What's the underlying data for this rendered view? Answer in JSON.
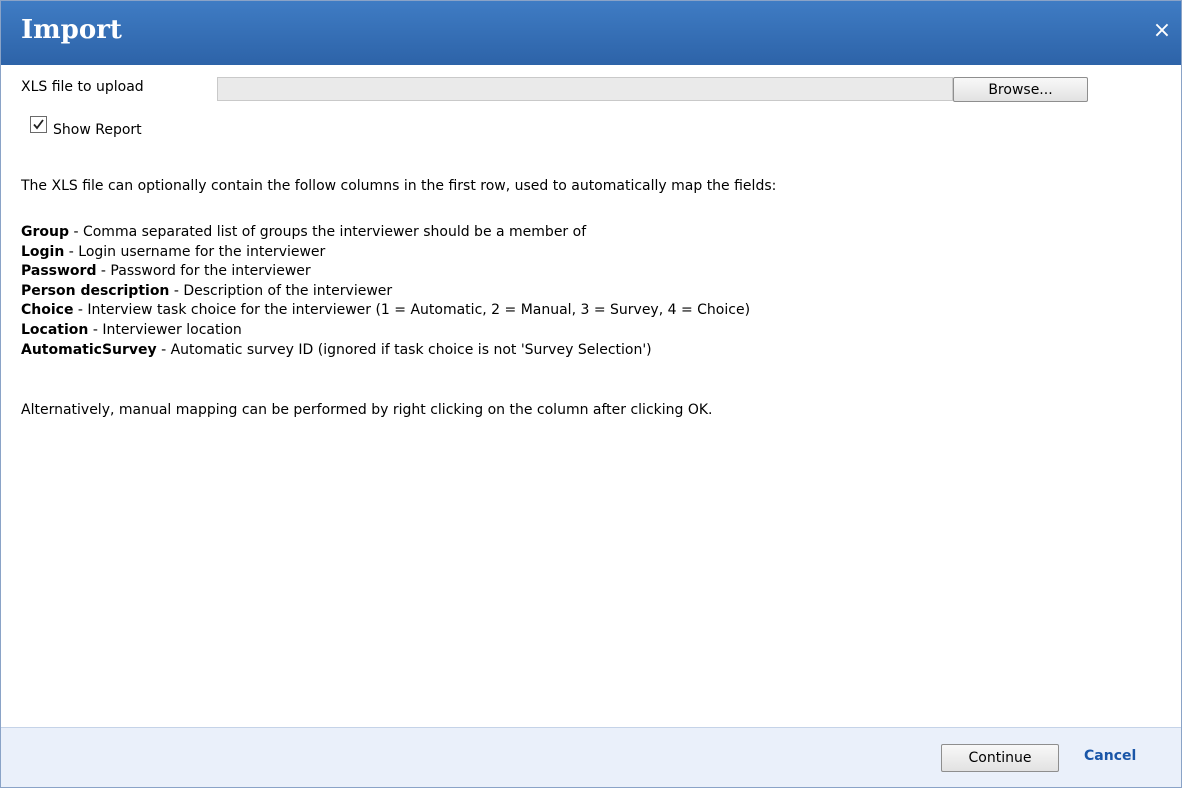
{
  "dialog": {
    "title": "Import",
    "close_glyph": "×",
    "icons": {
      "close": "close-icon",
      "checkmark": "checkmark-icon"
    }
  },
  "upload": {
    "label": "XLS file to upload",
    "file_value": "",
    "browse_label": "Browse..."
  },
  "show_report": {
    "label": "Show Report",
    "checked": true
  },
  "intro_text": "The XLS file can optionally contain the follow columns in the first row, used to automatically map the fields:",
  "fields": [
    {
      "name": "Group",
      "description": " - Comma separated list of groups the interviewer should be a member of"
    },
    {
      "name": "Login",
      "description": " - Login username for the interviewer"
    },
    {
      "name": "Password",
      "description": " - Password for the interviewer"
    },
    {
      "name": "Person description",
      "description": " - Description of the interviewer"
    },
    {
      "name": "Choice",
      "description": " - Interview task choice for the interviewer (1 = Automatic, 2 = Manual, 3 = Survey, 4 = Choice)"
    },
    {
      "name": "Location",
      "description": " - Interviewer location"
    },
    {
      "name": "AutomaticSurvey",
      "description": " - Automatic survey ID (ignored if task choice is not 'Survey Selection')"
    }
  ],
  "outro_text": "Alternatively, manual mapping can be performed by right clicking on the column after clicking OK.",
  "footer": {
    "continue_label": "Continue",
    "cancel_label": "Cancel"
  },
  "colors": {
    "titlebar": "#3a74bd",
    "footer_bg": "#eaf0fa",
    "link": "#1a56a8"
  }
}
